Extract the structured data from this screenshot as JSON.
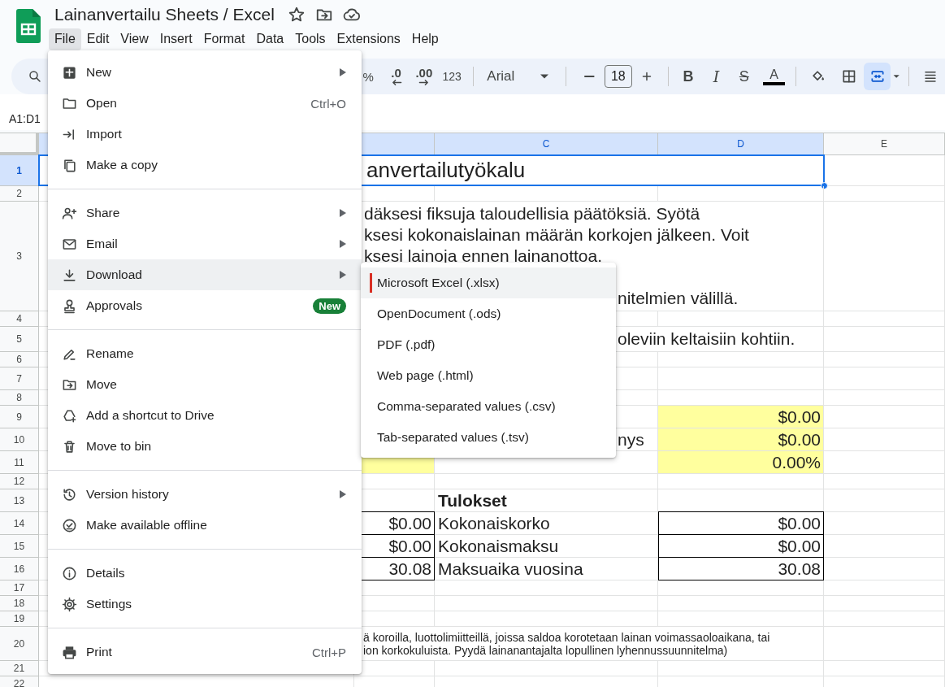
{
  "header": {
    "title": "Lainanvertailu Sheets / Excel"
  },
  "menu_bar": [
    {
      "label": "File",
      "selected": true
    },
    {
      "label": "Edit",
      "selected": false
    },
    {
      "label": "View",
      "selected": false
    },
    {
      "label": "Insert",
      "selected": false
    },
    {
      "label": "Format",
      "selected": false
    },
    {
      "label": "Data",
      "selected": false
    },
    {
      "label": "Tools",
      "selected": false
    },
    {
      "label": "Extensions",
      "selected": false
    },
    {
      "label": "Help",
      "selected": false
    }
  ],
  "toolbar": {
    "percent": "%",
    "decrease_decimal": ".0",
    "increase_decimal": ".00",
    "number_format": "123",
    "font": "Arial",
    "font_size": "18",
    "bold": "B",
    "italic": "I",
    "strikethrough": "S",
    "text_color": "A",
    "merge_active": true
  },
  "name_box": "A1:D1",
  "columns": [
    {
      "selected": true
    },
    {
      "selected": true
    },
    {
      "label": "C",
      "selected": true
    },
    {
      "label": "D",
      "selected": true
    },
    {
      "label": "E",
      "selected": false
    }
  ],
  "rows": [
    {
      "number": "1",
      "selected": true,
      "kind": "title-text",
      "lines": [
        {
          "text": "anvertailutyökalu",
          "kind": "after-menu"
        }
      ]
    },
    {
      "number": "2",
      "selected": false,
      "kind": "empty"
    },
    {
      "number": "3",
      "selected": false,
      "kind": "body-text",
      "lines": [
        {
          "text": "däksesi fiksuja taloudellisia päätöksiä. Syötä",
          "kind": "after-menu"
        },
        {
          "text": "ksesi kokonaislainan määrän korkojen jälkeen. Voit",
          "kind": "after-menu"
        },
        {
          "text": "ksesi lainoja ennen lainanottoa.",
          "kind": "after-menu"
        },
        {
          "kind": "blank"
        },
        {
          "text": "nitelmien välillä.",
          "kind": "after-submenu"
        }
      ]
    },
    {
      "number": "4",
      "selected": false,
      "kind": "empty"
    },
    {
      "number": "5",
      "selected": false,
      "kind": "body-text",
      "lines": [
        {
          "text": "oleviin keltaisiin kohtiin.",
          "kind": "after-submenu"
        }
      ]
    },
    {
      "number": "6",
      "selected": false,
      "kind": "empty"
    },
    {
      "number": "7",
      "selected": false,
      "kind": "cells"
    },
    {
      "number": "8",
      "selected": false,
      "kind": "empty"
    },
    {
      "number": "9",
      "selected": false,
      "kind": "cells",
      "d": {
        "text": "$0.00",
        "kind": "input"
      }
    },
    {
      "number": "10",
      "selected": false,
      "kind": "cells",
      "c_tail": {
        "text": "nys"
      },
      "d": {
        "text": "$0.00",
        "kind": "input"
      }
    },
    {
      "number": "11",
      "selected": false,
      "kind": "cells",
      "b": {
        "kind": "input"
      },
      "d": {
        "text": "0.00%",
        "kind": "input"
      }
    },
    {
      "number": "12",
      "selected": false,
      "kind": "empty"
    },
    {
      "number": "13",
      "selected": false,
      "kind": "cells",
      "c": {
        "text": "Tulokset",
        "bold": true
      }
    },
    {
      "number": "14",
      "selected": false,
      "kind": "cells",
      "b": {
        "text": "$0.00",
        "kind": "output"
      },
      "c": {
        "text": "Kokonaiskorko"
      },
      "d": {
        "text": "$0.00",
        "kind": "output"
      }
    },
    {
      "number": "15",
      "selected": false,
      "kind": "cells",
      "b": {
        "text": "$0.00",
        "kind": "output"
      },
      "c": {
        "text": "Kokonaismaksu"
      },
      "d": {
        "text": "$0.00",
        "kind": "output"
      }
    },
    {
      "number": "16",
      "selected": false,
      "kind": "cells",
      "b": {
        "text": "30.08",
        "kind": "output"
      },
      "c": {
        "text": "Maksuaika vuosina"
      },
      "d": {
        "text": "30.08",
        "kind": "output"
      }
    },
    {
      "number": "17",
      "selected": false,
      "kind": "empty"
    },
    {
      "number": "18",
      "selected": false,
      "kind": "empty"
    },
    {
      "number": "19",
      "selected": false,
      "kind": "empty"
    },
    {
      "number": "20",
      "selected": false,
      "kind": "note-text",
      "lines": [
        {
          "text": "ä koroilla, luottolimiitteillä, joissa saldoa korotetaan lainan voimassaoloaikana, tai",
          "kind": "after-menu"
        },
        {
          "text": "ion korkokuluista. Pyydä lainanantajalta lopullinen lyhennussuunnitelma)",
          "kind": "after-menu"
        }
      ]
    },
    {
      "number": "21",
      "selected": false,
      "kind": "empty"
    },
    {
      "number": "22",
      "selected": false,
      "kind": "empty"
    }
  ],
  "file_menu": {
    "items": [
      {
        "label": "New",
        "has_submenu": true,
        "separator_before": false,
        "selected": false
      },
      {
        "label": "Open",
        "shortcut": "Ctrl+O",
        "has_submenu": false,
        "separator_before": false,
        "selected": false
      },
      {
        "label": "Import",
        "has_submenu": false,
        "separator_before": false,
        "selected": false
      },
      {
        "label": "Make a copy",
        "has_submenu": false,
        "separator_before": false,
        "selected": false
      },
      {
        "label": "Share",
        "has_submenu": true,
        "separator_before": true,
        "selected": false
      },
      {
        "label": "Email",
        "has_submenu": true,
        "separator_before": false,
        "selected": false
      },
      {
        "label": "Download",
        "has_submenu": true,
        "separator_before": false,
        "selected": true
      },
      {
        "label": "Approvals",
        "badge": "New",
        "has_submenu": false,
        "separator_before": false,
        "selected": false
      },
      {
        "label": "Rename",
        "has_submenu": false,
        "separator_before": true,
        "selected": false
      },
      {
        "label": "Move",
        "has_submenu": false,
        "separator_before": false,
        "selected": false
      },
      {
        "label": "Add a shortcut to Drive",
        "has_submenu": false,
        "separator_before": false,
        "selected": false
      },
      {
        "label": "Move to bin",
        "has_submenu": false,
        "separator_before": false,
        "selected": false
      },
      {
        "label": "Version history",
        "has_submenu": true,
        "separator_before": true,
        "selected": false
      },
      {
        "label": "Make available offline",
        "has_submenu": false,
        "separator_before": false,
        "selected": false
      },
      {
        "label": "Details",
        "has_submenu": false,
        "separator_before": true,
        "selected": false
      },
      {
        "label": "Settings",
        "has_submenu": false,
        "separator_before": false,
        "selected": false
      },
      {
        "label": "Print",
        "shortcut": "Ctrl+P",
        "has_submenu": false,
        "separator_before": true,
        "selected": false
      }
    ]
  },
  "download_submenu": {
    "items": [
      {
        "label": "Microsoft Excel (.xlsx)",
        "selected": true
      },
      {
        "label": "OpenDocument (.ods)",
        "selected": false
      },
      {
        "label": "PDF (.pdf)",
        "selected": false
      },
      {
        "label": "Web page (.html)",
        "selected": false
      },
      {
        "label": "Comma-separated values (.csv)",
        "selected": false
      },
      {
        "label": "Tab-separated values (.tsv)",
        "selected": false
      }
    ]
  }
}
